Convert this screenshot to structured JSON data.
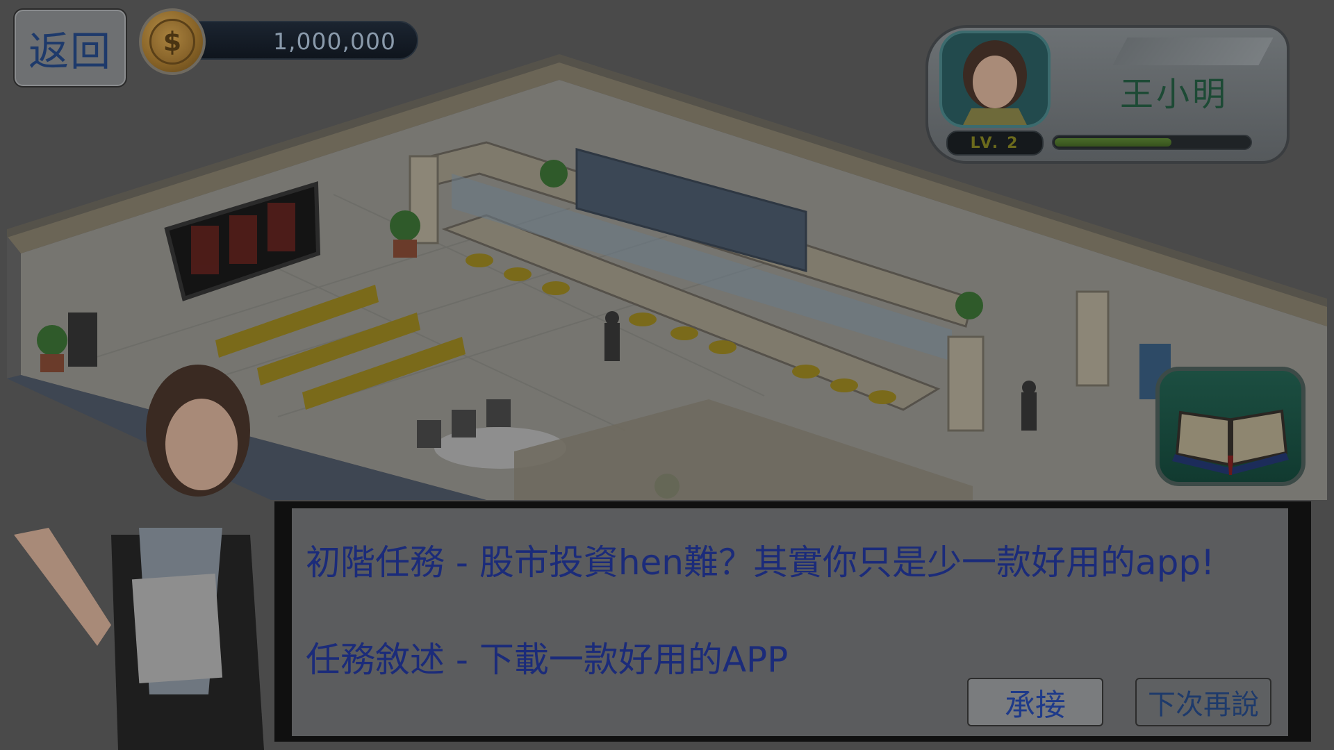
{
  "top_left": {
    "back_label": "返回",
    "coin_symbol": "$",
    "coins": "1,000,000"
  },
  "player": {
    "name": "王小明",
    "level_prefix": "LV.",
    "level_value": "2",
    "exp_fraction": 0.6
  },
  "mission_dialog": {
    "title": "初階任務 - 股市投資hen難？其實你只是少一款好用的app!",
    "description": "任務敘述 - 下載一款好用的APP",
    "accept_label": "承接",
    "later_label": "下次再說"
  },
  "colors": {
    "dialog_text": "#1b2b7a",
    "player_name": "#1d4a35",
    "background_dim": "#4a4a4a"
  },
  "icons": {
    "coin": "dollar-coin-icon",
    "journal": "open-book-icon"
  }
}
